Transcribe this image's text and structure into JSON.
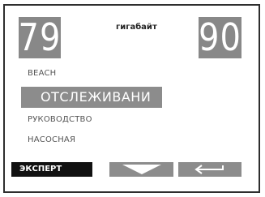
{
  "display": {
    "left_value": "79",
    "right_value": "90",
    "unit": "гигабайт"
  },
  "menu": {
    "items": [
      {
        "label": "BEACH"
      },
      {
        "label": "ОТСЛЕЖИВАНИ",
        "selected": true
      },
      {
        "label": "РУКОВОДСТВО"
      },
      {
        "label": "НАСОСНАЯ"
      }
    ]
  },
  "softkeys": {
    "expert_label": "ЭКСПЕРТ",
    "down_icon": "chevron-down-icon",
    "back_icon": "return-arrow-icon"
  },
  "colors": {
    "highlight": "#8c8c8c",
    "active_key": "#111111",
    "frame": "#2e2e2e"
  }
}
